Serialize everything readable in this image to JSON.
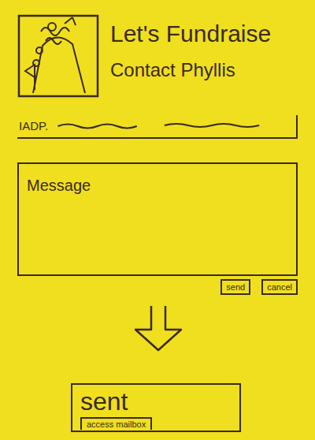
{
  "header": {
    "title": "Let's Fundraise",
    "subtitle": "Contact Phyllis"
  },
  "field": {
    "label": "IADP."
  },
  "message": {
    "label": "Message"
  },
  "buttons": [
    {
      "label": "send"
    },
    {
      "label": "cancel"
    }
  ],
  "confirmation": {
    "title": "sent",
    "button": "access mailbox"
  }
}
